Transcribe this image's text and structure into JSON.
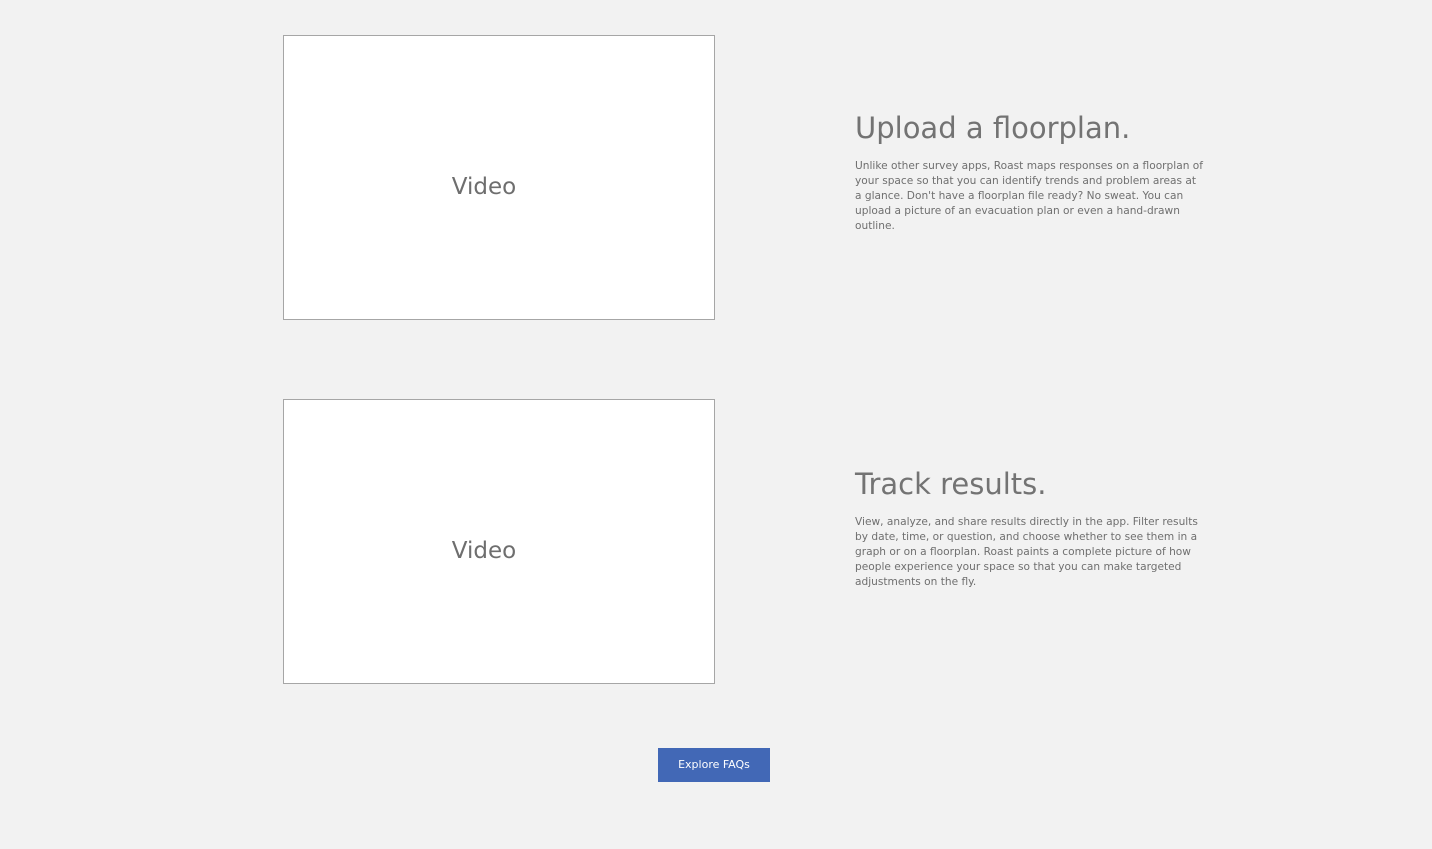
{
  "features": [
    {
      "video_label": "Video",
      "title": "Upload a floorplan.",
      "body": "Unlike other survey apps, Roast maps responses on a floorplan of your space so that you can identify trends and problem areas at a glance. Don't have a floorplan file ready? No sweat. You can upload a picture of an evacuation plan or even a hand-drawn outline."
    },
    {
      "video_label": "Video",
      "title": "Track results.",
      "body": "View, analyze, and share results directly in the app. Filter results by date, time, or question, and choose whether to see them in a graph or on a floorplan. Roast paints a complete picture of how people experience your space so that you can make targeted adjustments on the fly."
    }
  ],
  "cta": {
    "label": "Explore FAQs"
  },
  "colors": {
    "background": "#f2f2f2",
    "video_fill": "#ffffff",
    "video_border": "#a6a6a6",
    "text": "#6b6b6b",
    "button": "#4268b6",
    "button_text": "#ffffff"
  }
}
